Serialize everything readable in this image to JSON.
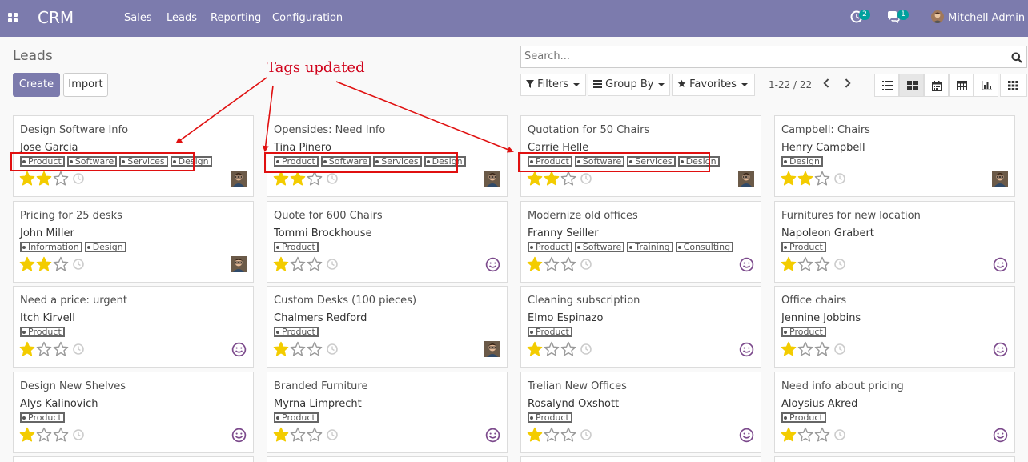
{
  "navbar": {
    "brand": "CRM",
    "menus": [
      "Sales",
      "Leads",
      "Reporting",
      "Configuration"
    ],
    "activity_count": "2",
    "message_count": "1",
    "user_name": "Mitchell Admin",
    "bg_color": "#7c7bad"
  },
  "control_panel": {
    "title": "Leads",
    "create_label": "Create",
    "import_label": "Import",
    "search_placeholder": "Search...",
    "filters_label": "Filters",
    "group_by_label": "Group By",
    "favorites_label": "Favorites",
    "pager": "1-22 / 22",
    "views": [
      "list-view-icon",
      "kanban-view-icon",
      "calendar-view-icon",
      "pivot-view-icon",
      "graph-view-icon",
      "grid-view-icon"
    ],
    "active_view": "kanban-view-icon"
  },
  "annotation": {
    "label": "Tags updated",
    "color": "#d0021b"
  },
  "cards": [
    {
      "title": "Design Software Info",
      "contact": "Jose Garcia",
      "tags": [
        "Product",
        "Software",
        "Services",
        "Design"
      ],
      "stars": 2,
      "assignee": "photo"
    },
    {
      "title": "Opensides: Need Info",
      "contact": "Tina Pinero",
      "tags": [
        "Product",
        "Software",
        "Services",
        "Design"
      ],
      "stars": 2,
      "assignee": "photo"
    },
    {
      "title": "Quotation for 50 Chairs",
      "contact": "Carrie Helle",
      "tags": [
        "Product",
        "Software",
        "Services",
        "Design"
      ],
      "stars": 2,
      "assignee": "photo"
    },
    {
      "title": "Campbell: Chairs",
      "contact": "Henry Campbell",
      "tags": [
        "Design"
      ],
      "stars": 2,
      "assignee": "photo"
    },
    {
      "title": "Pricing for 25 desks",
      "contact": "John Miller",
      "tags": [
        "Information",
        "Design"
      ],
      "stars": 2,
      "assignee": "photo"
    },
    {
      "title": "Quote for 600 Chairs",
      "contact": "Tommi Brockhouse",
      "tags": [
        "Product"
      ],
      "stars": 1,
      "assignee": "smiley"
    },
    {
      "title": "Modernize old offices",
      "contact": "Franny Seiller",
      "tags": [
        "Product",
        "Software",
        "Training",
        "Consulting"
      ],
      "stars": 1,
      "assignee": "smiley"
    },
    {
      "title": "Furnitures for new location",
      "contact": "Napoleon Grabert",
      "tags": [
        "Product"
      ],
      "stars": 1,
      "assignee": "smiley"
    },
    {
      "title": "Need a price: urgent",
      "contact": "Itch Kirvell",
      "tags": [
        "Product"
      ],
      "stars": 1,
      "assignee": "smiley"
    },
    {
      "title": "Custom Desks (100 pieces)",
      "contact": "Chalmers Redford",
      "tags": [
        "Product"
      ],
      "stars": 1,
      "assignee": "photo"
    },
    {
      "title": "Cleaning subscription",
      "contact": "Elmo Espinazo",
      "tags": [
        "Product"
      ],
      "stars": 1,
      "assignee": "smiley"
    },
    {
      "title": "Office chairs",
      "contact": "Jennine Jobbins",
      "tags": [
        "Product"
      ],
      "stars": 1,
      "assignee": "smiley"
    },
    {
      "title": "Design New Shelves",
      "contact": "Alys Kalinovich",
      "tags": [
        "Product"
      ],
      "stars": 1,
      "assignee": "smiley"
    },
    {
      "title": "Branded Furniture",
      "contact": "Myrna Limprecht",
      "tags": [
        "Product"
      ],
      "stars": 1,
      "assignee": "smiley"
    },
    {
      "title": "Trelian New Offices",
      "contact": "Rosalynd Oxshott",
      "tags": [
        "Product"
      ],
      "stars": 1,
      "assignee": "smiley"
    },
    {
      "title": "Need info about pricing",
      "contact": "Aloysius Akred",
      "tags": [
        "Product"
      ],
      "stars": 1,
      "assignee": "smiley"
    }
  ]
}
